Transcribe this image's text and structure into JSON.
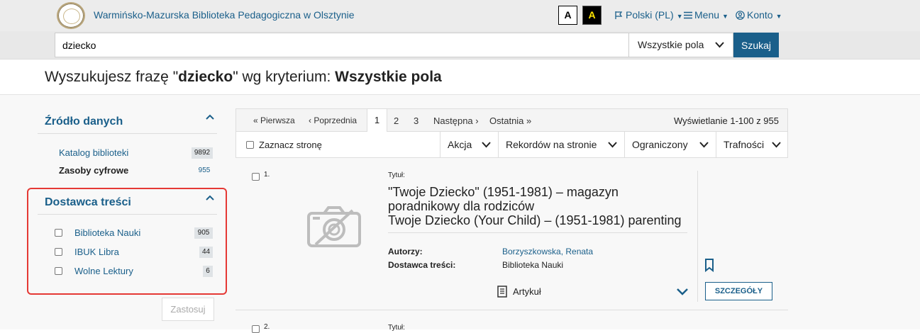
{
  "header": {
    "library_name": "Warmińsko-Mazurska Biblioteka Pedagogiczna w Olsztynie",
    "contrast_normal": "A",
    "contrast_high": "A",
    "language": "Polski (PL)",
    "menu": "Menu",
    "account": "Konto"
  },
  "search": {
    "query": "dziecko",
    "field": "Wszystkie pola",
    "submit": "Szukaj"
  },
  "heading": {
    "prefix": "Wyszukujesz frazę \"",
    "term": "dziecko",
    "middle": "\" wg kryterium: ",
    "criterion": "Wszystkie pola"
  },
  "sidebar": {
    "source": {
      "title": "Źródło danych",
      "items": [
        {
          "label": "Katalog biblioteki",
          "count": "9892"
        },
        {
          "label": "Zasoby cyfrowe",
          "count": "955"
        }
      ]
    },
    "provider": {
      "title": "Dostawca treści",
      "items": [
        {
          "label": "Biblioteka Nauki",
          "count": "905"
        },
        {
          "label": "IBUK Libra",
          "count": "44"
        },
        {
          "label": "Wolne Lektury",
          "count": "6"
        }
      ]
    },
    "apply": "Zastosuj"
  },
  "pager": {
    "first": "« Pierwsza",
    "prev": "‹ Poprzednia",
    "pages": [
      "1",
      "2",
      "3"
    ],
    "next": "Następna ›",
    "last": "Ostatnia »",
    "info": "Wyświetlanie 1-100 z 955"
  },
  "toolbar": {
    "select_page": "Zaznacz stronę",
    "action": "Akcja",
    "per_page": "Rekordów na stronie",
    "limited": "Ograniczony",
    "sort": "Trafności"
  },
  "results": [
    {
      "number": "1.",
      "title_label": "Tytuł:",
      "title_lines": [
        "\"Twoje Dziecko\" (1951-1981) – magazyn",
        "poradnikowy dla rodziców",
        "Twoje Dziecko (Your Child) – (1951-1981) parenting"
      ],
      "authors_label": "Autorzy:",
      "authors": "Borzyszkowska, Renata",
      "provider_label": "Dostawca treści:",
      "provider": "Biblioteka Nauki",
      "format": "Artykuł",
      "details": "SZCZEGÓŁY"
    },
    {
      "number": "2.",
      "title_label": "Tytuł:"
    }
  ]
}
